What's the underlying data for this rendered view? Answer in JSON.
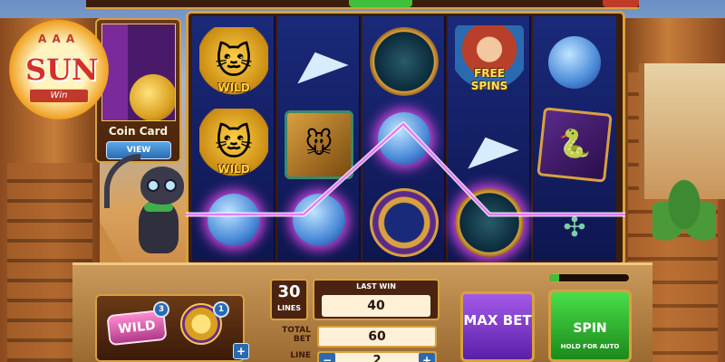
{
  "logo": {
    "text": "SUN",
    "ribbon": "Win",
    "cards": "A A A"
  },
  "coin_card": {
    "label": "Coin Card",
    "view_label": "VIEW"
  },
  "reels": [
    [
      {
        "symbol": "cat",
        "caption": "WILD"
      },
      {
        "symbol": "cat",
        "caption": "WILD"
      },
      {
        "symbol": "yarn",
        "caption": ""
      }
    ],
    [
      {
        "symbol": "paper-plane",
        "caption": ""
      },
      {
        "symbol": "mouse",
        "caption": ""
      },
      {
        "symbol": "yarn",
        "caption": ""
      }
    ],
    [
      {
        "symbol": "scarab",
        "caption": ""
      },
      {
        "symbol": "yarn",
        "caption": ""
      },
      {
        "symbol": "compass",
        "caption": ""
      }
    ],
    [
      {
        "symbol": "girl",
        "caption": "FREE SPINS"
      },
      {
        "symbol": "paper-plane",
        "caption": ""
      },
      {
        "symbol": "scarab",
        "caption": ""
      }
    ],
    [
      {
        "symbol": "yarn",
        "caption": ""
      },
      {
        "symbol": "snake",
        "caption": ""
      },
      {
        "symbol": "dragonfly",
        "caption": ""
      }
    ]
  ],
  "bonus": {
    "wild_label": "WILD",
    "wild_count": "3",
    "coin_count": "1",
    "plus": "+"
  },
  "lines": {
    "value": "30",
    "label": "LINES"
  },
  "last_win": {
    "label": "LAST WIN",
    "value": "40"
  },
  "total_bet": {
    "label": "TOTAL BET",
    "value": "60"
  },
  "line_bet": {
    "label": "LINE",
    "value": "2",
    "minus": "−",
    "plus": "+"
  },
  "max_bet": {
    "label": "MAX BET"
  },
  "spin": {
    "label": "SPIN",
    "sub": "HOLD FOR AUTO"
  },
  "progress": {
    "fraction": 0.12
  },
  "colors": {
    "win_line": "#e879f9",
    "spin": "#1a8a1a",
    "max_bet": "#5a1fa8",
    "frame": "#d9a040"
  }
}
